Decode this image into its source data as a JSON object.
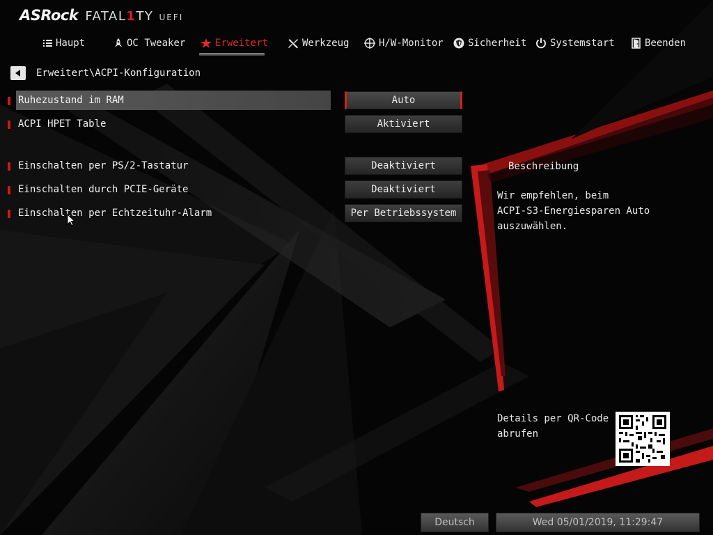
{
  "logo": {
    "brand": "ASRock",
    "product_pre": "FATAL",
    "product_one": "1",
    "product_post": "TY",
    "suffix": "UEFI"
  },
  "nav": {
    "items": [
      {
        "label": "Haupt",
        "icon": "list-icon"
      },
      {
        "label": "OC Tweaker",
        "icon": "rocket-icon"
      },
      {
        "label": "Erweitert",
        "icon": "star-icon",
        "active": true
      },
      {
        "label": "Werkzeug",
        "icon": "tools-icon"
      },
      {
        "label": "H/W-Monitor",
        "icon": "crosshair-icon"
      },
      {
        "label": "Sicherheit",
        "icon": "shield-icon"
      },
      {
        "label": "Systemstart",
        "icon": "power-icon"
      },
      {
        "label": "Beenden",
        "icon": "exit-door-icon"
      }
    ]
  },
  "breadcrumb": {
    "path": "Erweitert\\ACPI-Konfiguration"
  },
  "settings": [
    {
      "label": "Ruhezustand im RAM",
      "value": "Auto",
      "selected": true
    },
    {
      "label": "ACPI HPET Table",
      "value": "Aktiviert"
    },
    {
      "label": "Einschalten per PS/2-Tastatur",
      "value": "Deaktiviert"
    },
    {
      "label": "Einschalten durch PCIE-Geräte",
      "value": "Deaktiviert"
    },
    {
      "label": "Einschalten per Echtzeituhr-Alarm",
      "value": "Per Betriebssystem"
    }
  ],
  "description": {
    "title": "Beschreibung",
    "text": "Wir empfehlen, beim\nACPI-S3-Energiesparen Auto\nauszuwählen.",
    "qr_text": "Details per QR-Code\nabrufen"
  },
  "footer": {
    "language": "Deutsch",
    "datetime": "Wed 05/01/2019, 11:29:47"
  },
  "colors": {
    "accent": "#d42020",
    "background": "#050505",
    "selected_row": "#4f4f4f"
  }
}
